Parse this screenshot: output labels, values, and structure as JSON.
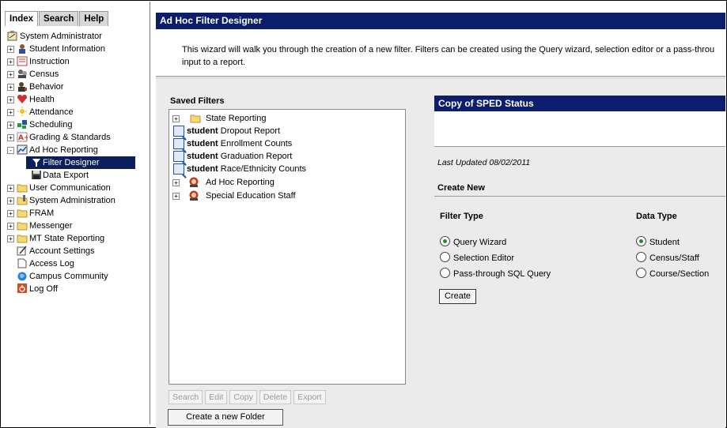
{
  "tabs": [
    "Index",
    "Search",
    "Help"
  ],
  "nav": {
    "items": [
      {
        "label": "System Administrator",
        "expander": "",
        "icon": "clipboard-icon"
      },
      {
        "label": "Student Information",
        "expander": "+",
        "icon": "student-icon"
      },
      {
        "label": "Instruction",
        "expander": "+",
        "icon": "instruction-icon"
      },
      {
        "label": "Census",
        "expander": "+",
        "icon": "census-icon"
      },
      {
        "label": "Behavior",
        "expander": "+",
        "icon": "behavior-icon"
      },
      {
        "label": "Health",
        "expander": "+",
        "icon": "health-icon"
      },
      {
        "label": "Attendance",
        "expander": "+",
        "icon": "attendance-icon"
      },
      {
        "label": "Scheduling",
        "expander": "+",
        "icon": "scheduling-icon"
      },
      {
        "label": "Grading & Standards",
        "expander": "+",
        "icon": "grading-icon"
      },
      {
        "label": "Ad Hoc Reporting",
        "expander": "-",
        "icon": "adhoc-icon"
      },
      {
        "label": "Filter Designer",
        "expander": "",
        "icon": "filter-icon"
      },
      {
        "label": "Data Export",
        "expander": "",
        "icon": "save-icon"
      },
      {
        "label": "User Communication",
        "expander": "+",
        "icon": "folder-icon"
      },
      {
        "label": "System Administration",
        "expander": "+",
        "icon": "sysadmin-icon"
      },
      {
        "label": "FRAM",
        "expander": "+",
        "icon": "folder-icon"
      },
      {
        "label": "Messenger",
        "expander": "+",
        "icon": "folder-icon"
      },
      {
        "label": "MT State Reporting",
        "expander": "+",
        "icon": "folder-icon"
      },
      {
        "label": "Account Settings",
        "expander": "",
        "icon": "settings-icon"
      },
      {
        "label": "Access Log",
        "expander": "",
        "icon": "document-icon"
      },
      {
        "label": "Campus Community",
        "expander": "",
        "icon": "community-icon"
      },
      {
        "label": "Log Off",
        "expander": "",
        "icon": "power-icon"
      }
    ]
  },
  "header": {
    "title": "Ad Hoc Filter Designer"
  },
  "intro": {
    "line1": "This wizard will walk you through the creation of a new filter. Filters can be created using the Query wizard, selection editor or a pass-throu",
    "line2": "input to a report."
  },
  "saved": {
    "title": "Saved Filters",
    "items": [
      {
        "prefix": "",
        "label": "State Reporting",
        "expander": "+",
        "icon": "folder-icon"
      },
      {
        "prefix": "student",
        "label": "Dropout Report",
        "expander": "",
        "icon": "magnifier-icon"
      },
      {
        "prefix": "student",
        "label": "Enrollment Counts",
        "expander": "",
        "icon": "magnifier-icon"
      },
      {
        "prefix": "student",
        "label": "Graduation Report",
        "expander": "",
        "icon": "magnifier-icon"
      },
      {
        "prefix": "student",
        "label": "Race/Ethnicity Counts",
        "expander": "",
        "icon": "magnifier-icon"
      },
      {
        "prefix": "",
        "label": "Ad Hoc Reporting",
        "expander": "+",
        "icon": "shared-folder-icon"
      },
      {
        "prefix": "",
        "label": "Special Education Staff",
        "expander": "+",
        "icon": "shared-folder-icon"
      }
    ],
    "buttons": [
      "Search",
      "Edit",
      "Copy",
      "Delete",
      "Export"
    ],
    "new_folder": "Create a new Folder"
  },
  "selected": {
    "title": "Copy of SPED Status",
    "last_updated": "Last Updated 08/02/2011"
  },
  "create": {
    "heading": "Create New",
    "filter_type_title": "Filter Type",
    "data_type_title": "Data Type",
    "filter_types": [
      {
        "label": "Query Wizard",
        "checked": true
      },
      {
        "label": "Selection Editor",
        "checked": false
      },
      {
        "label": "Pass-through SQL Query",
        "checked": false
      }
    ],
    "data_types": [
      {
        "label": "Student",
        "checked": true
      },
      {
        "label": "Census/Staff",
        "checked": false
      },
      {
        "label": "Course/Section",
        "checked": false
      }
    ],
    "button": "Create"
  },
  "colors": {
    "header_bg": "#0b1d6b",
    "selection_bg": "#0a1f5c",
    "content_bg": "#ebebeb",
    "radio_on": "#2a8a2a"
  }
}
